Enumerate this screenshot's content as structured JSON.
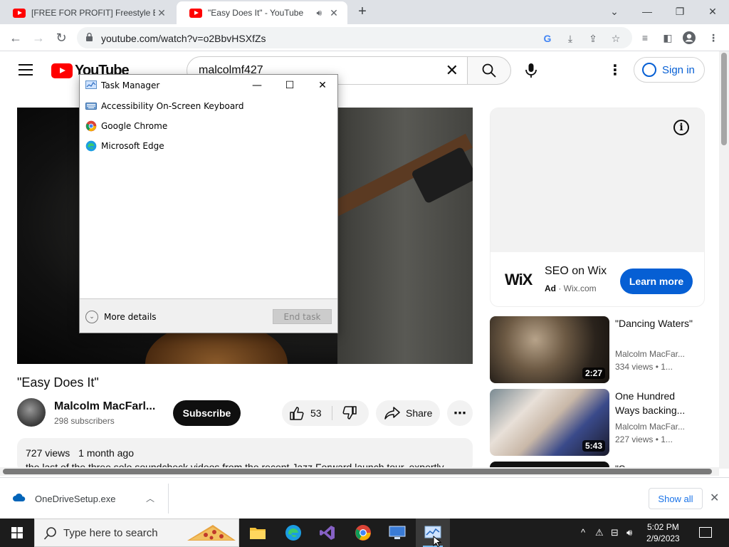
{
  "browser": {
    "tabs": [
      {
        "title": "[FREE FOR PROFIT] Freestyle Beat",
        "active": false
      },
      {
        "title": "\"Easy Does It\" - YouTube",
        "active": true,
        "playing_audio": true
      }
    ],
    "url": "youtube.com/watch?v=o2BbvHSXfZs"
  },
  "youtube": {
    "logo_text": "YouTube",
    "search_query": "malcolmf427",
    "sign_in_label": "Sign in",
    "video_title": "\"Easy Does It\"",
    "channel_name": "Malcolm MacFarl...",
    "subscribers": "298 subscribers",
    "subscribe_label": "Subscribe",
    "like_count": "53",
    "share_label": "Share",
    "views": "727 views",
    "age": "1 month ago",
    "description": "the last of the three solo soundcheck videos from the recent Jazz Forward launch tour, expertly"
  },
  "ad": {
    "brand": "WiX",
    "headline": "SEO on Wix",
    "ad_badge": "Ad",
    "domain": "Wix.com",
    "cta": "Learn more"
  },
  "related": [
    {
      "title": "\"Dancing Waters\"",
      "channel": "Malcolm MacFar...",
      "views": "334 views",
      "age": "1...",
      "duration": "2:27"
    },
    {
      "title": "One Hundred Ways backing...",
      "channel": "Malcolm MacFar...",
      "views": "227 views",
      "age": "1...",
      "duration": "5:43"
    },
    {
      "title": "\"S",
      "channel": "",
      "views": "",
      "age": "",
      "duration": ""
    }
  ],
  "downloads": {
    "file": "OneDriveSetup.exe",
    "show_all": "Show all"
  },
  "task_manager": {
    "title": "Task Manager",
    "processes": [
      "Accessibility On-Screen Keyboard",
      "Google Chrome",
      "Microsoft Edge"
    ],
    "more_details": "More details",
    "end_task": "End task"
  },
  "taskbar": {
    "search_placeholder": "Type here to search",
    "time": "5:02 PM",
    "date": "2/9/2023",
    "apps": [
      "file-explorer",
      "edge",
      "visual-studio",
      "chrome",
      "remote-desktop",
      "task-manager"
    ]
  },
  "colors": {
    "youtube_red": "#ff0000",
    "link_blue": "#065fd4",
    "chrome_tabstrip": "#dee1e6",
    "taskbar": "#1c1c1c"
  }
}
